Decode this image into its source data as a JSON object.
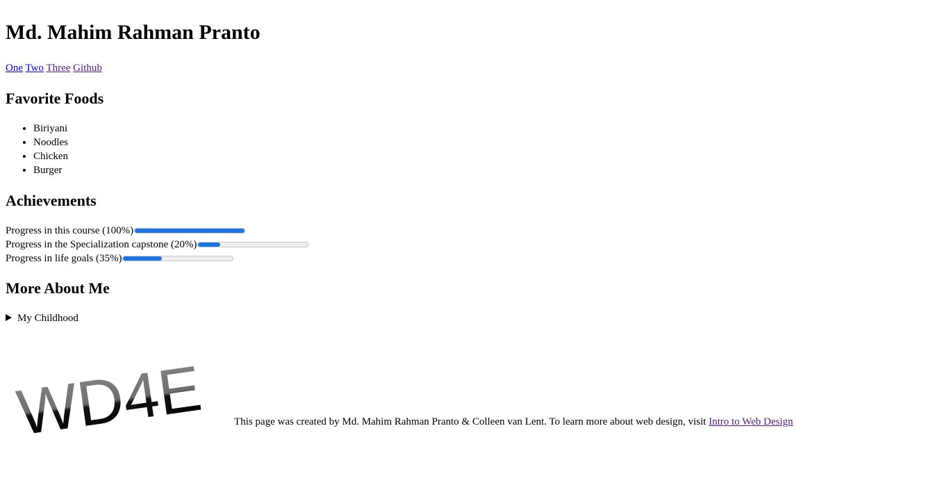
{
  "header": {
    "title": "Md. Mahim Rahman Pranto"
  },
  "nav": {
    "links": [
      "One",
      "Two",
      "Three",
      "Github"
    ]
  },
  "favorites": {
    "heading": "Favorite Foods",
    "items": [
      "Biriyani",
      "Noodles",
      "Chicken",
      "Burger"
    ]
  },
  "achievements": {
    "heading": "Achievements",
    "items": [
      {
        "label": "Progress in this course (100%)",
        "value": 1.0
      },
      {
        "label": "Progress in the Specialization capstone (20%)",
        "value": 0.2
      },
      {
        "label": "Progress in life goals (35%)",
        "value": 0.35
      }
    ]
  },
  "more": {
    "heading": "More About Me",
    "summary": "My Childhood"
  },
  "logo": {
    "text": "WD4E"
  },
  "footer": {
    "text": "This page was created by Md. Mahim Rahman Pranto & Colleen van Lent. To learn more about web design, visit ",
    "link_text": "Intro to Web Design"
  },
  "colors": {
    "progress_fill": "#1a73e8",
    "link": "#0000ee",
    "visited": "#551a8b"
  }
}
